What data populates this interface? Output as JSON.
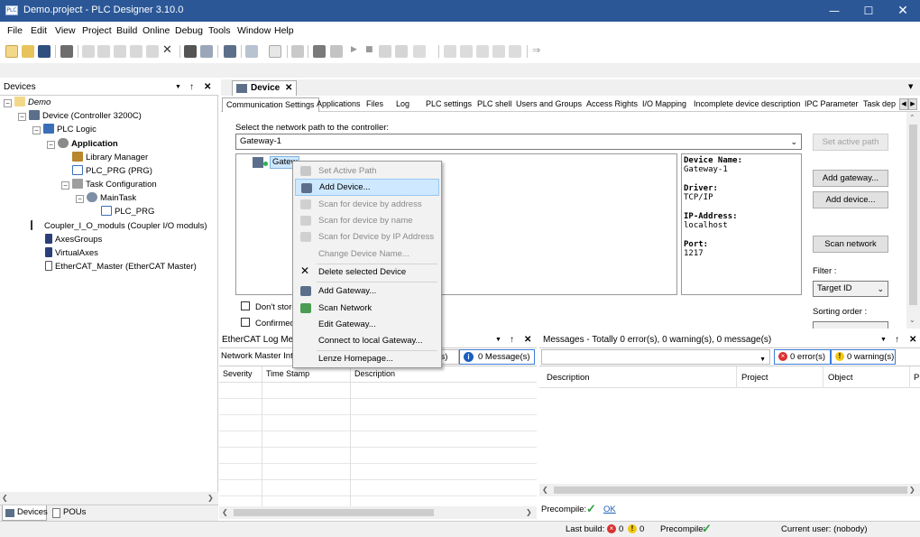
{
  "window": {
    "title": "Demo.project - PLC Designer 3.10.0",
    "app_icon_text": "PLC"
  },
  "menu": [
    "File",
    "Edit",
    "View",
    "Project",
    "Build",
    "Online",
    "Debug",
    "Tools",
    "Window",
    "Help"
  ],
  "devices_panel": {
    "title": "Devices",
    "tree": [
      {
        "label": "Demo",
        "level": 0,
        "italic": true
      },
      {
        "label": "Device (Controller 3200C)",
        "level": 1
      },
      {
        "label": "PLC Logic",
        "level": 2
      },
      {
        "label": "Application",
        "level": 3,
        "bold": true
      },
      {
        "label": "Library Manager",
        "level": 4
      },
      {
        "label": "PLC_PRG (PRG)",
        "level": 4
      },
      {
        "label": "Task Configuration",
        "level": 4
      },
      {
        "label": "MainTask",
        "level": 5
      },
      {
        "label": "PLC_PRG",
        "level": 6
      },
      {
        "label": "Coupler_I_O_moduls (Coupler I/O moduls)",
        "level": 1
      },
      {
        "label": "AxesGroups",
        "level": 1
      },
      {
        "label": "VirtualAxes",
        "level": 1
      },
      {
        "label": "EtherCAT_Master (EtherCAT Master)",
        "level": 1
      }
    ],
    "bottom_tabs": [
      "Devices",
      "POUs"
    ]
  },
  "editor": {
    "doc_tab": "Device",
    "tabs": [
      "Communication Settings",
      "Applications",
      "Files",
      "Log",
      "PLC settings",
      "PLC shell",
      "Users and Groups",
      "Access Rights",
      "I/O Mapping",
      "Incomplete device description",
      "IPC Parameter",
      "Task dep"
    ],
    "network_prompt": "Select the network path to the controller:",
    "network_value": "Gateway-1",
    "set_active_path": "Set active path",
    "gateway_node": "Gatew",
    "device_info": {
      "name_label": "Device Name:",
      "name_value": "Gateway-1",
      "driver_label": "Driver:",
      "driver_value": "TCP/IP",
      "ip_label": "IP-Address:",
      "ip_value": "localhost",
      "port_label": "Port:",
      "port_value": "1217"
    },
    "add_gateway": "Add gateway...",
    "add_device": "Add device...",
    "scan_network": "Scan network",
    "filter_label": "Filter :",
    "filter_value": "Target ID",
    "sorting_label": "Sorting order :",
    "chk1": "Don't store",
    "chk2": "Confirmed o"
  },
  "context_menu": [
    {
      "label": "Set Active Path",
      "disabled": true,
      "icon": "set-path-icon"
    },
    {
      "label": "Add Device...",
      "highlight": true,
      "icon": "add-device-icon"
    },
    {
      "label": "Scan for device by address",
      "disabled": true,
      "icon": "scan-address-icon"
    },
    {
      "label": "Scan for device by name",
      "disabled": true,
      "icon": "scan-name-icon"
    },
    {
      "label": "Scan for Device by IP Address",
      "disabled": true,
      "icon": "scan-ip-icon"
    },
    {
      "label": "Change Device Name...",
      "disabled": true
    },
    {
      "sep": true
    },
    {
      "label": "Delete selected Device",
      "icon": "delete-icon"
    },
    {
      "sep": true
    },
    {
      "label": "Add Gateway...",
      "icon": "add-gateway-icon"
    },
    {
      "label": "Scan Network",
      "icon": "scan-network-icon"
    },
    {
      "label": "Edit Gateway..."
    },
    {
      "label": "Connect to local Gateway..."
    },
    {
      "sep": true
    },
    {
      "label": "Lenze Homepage..."
    }
  ],
  "ethercat_log": {
    "title": "EtherCAT Log Messa",
    "filter": "Network Master Inte",
    "warnings_frag": "g(s)",
    "messages": "0 Message(s)",
    "columns": [
      "Severity",
      "Time Stamp",
      "Description"
    ]
  },
  "messages_panel": {
    "title": "Messages - Totally 0 error(s), 0 warning(s), 0 message(s)",
    "errors": "0 error(s)",
    "warnings": "0 warning(s)",
    "columns": [
      "Description",
      "Project",
      "Object",
      "P"
    ]
  },
  "precompile": {
    "label": "Precompile:",
    "ok": "OK"
  },
  "status": {
    "last_build": "Last build:",
    "errors": "0",
    "warnings": "0",
    "precompile": "Precompile:",
    "user": "Current user: (nobody)"
  }
}
